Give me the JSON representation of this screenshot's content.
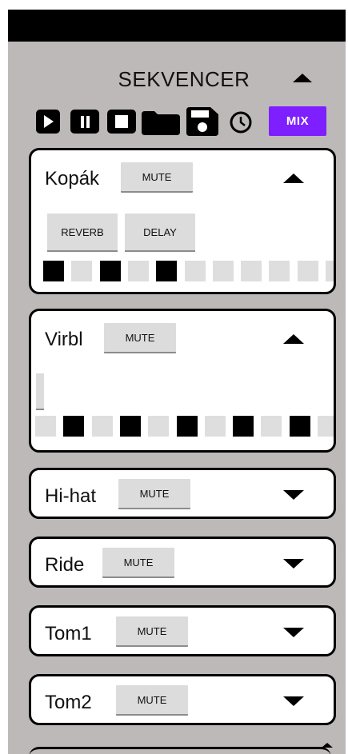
{
  "app": {
    "title": "SEKVENCER",
    "accent_color": "#7d1fff",
    "background_color": "#bdb9b8"
  },
  "toolbar": {
    "icons": [
      "play-icon",
      "pause-icon",
      "stop-icon",
      "folder-icon",
      "save-icon",
      "clock-icon"
    ],
    "mix_label": "MIX"
  },
  "tracks": [
    {
      "name": "Kopák",
      "mute_label": "MUTE",
      "expanded": true,
      "effects": [
        "REVERB",
        "DELAY"
      ],
      "steps": [
        1,
        0,
        1,
        0,
        1,
        0,
        0,
        0,
        0,
        0,
        0
      ]
    },
    {
      "name": "Virbl",
      "mute_label": "MUTE",
      "expanded": true,
      "effects": [],
      "steps": [
        0,
        1,
        0,
        1,
        0,
        1,
        0,
        1,
        0,
        1,
        0
      ]
    },
    {
      "name": "Hi-hat",
      "mute_label": "MUTE",
      "expanded": false
    },
    {
      "name": "Ride",
      "mute_label": "MUTE",
      "expanded": false
    },
    {
      "name": "Tom1",
      "mute_label": "MUTE",
      "expanded": false
    },
    {
      "name": "Tom2",
      "mute_label": "MUTE",
      "expanded": false
    }
  ]
}
